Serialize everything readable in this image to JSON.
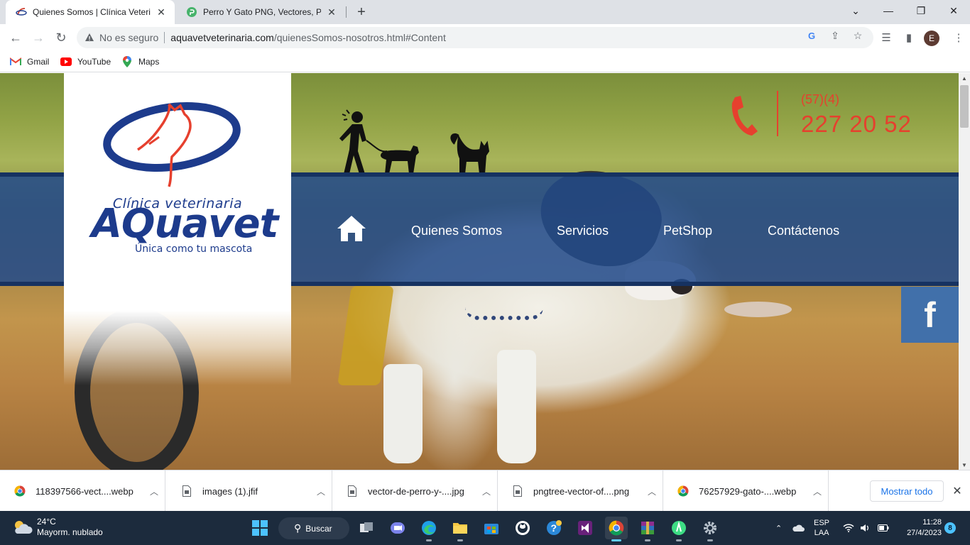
{
  "browser": {
    "tabs": [
      {
        "title": "Quienes Somos | Clínica Veterinaria",
        "active": true
      },
      {
        "title": "Perro Y Gato PNG, Vectores, PSD",
        "active": false
      }
    ],
    "security_label": "No es seguro",
    "url_domain": "aquavetveterinaria.com",
    "url_path": "/quienesSomos-nosotros.html#Content",
    "avatar_letter": "E",
    "bookmarks": [
      "Gmail",
      "YouTube",
      "Maps"
    ]
  },
  "site": {
    "logo": {
      "line1": "Clínica veterinaria",
      "brand": "AQuavet",
      "tagline": "Única como tu mascota"
    },
    "phone": {
      "area": "(57)(4)",
      "number": "227 20 52"
    },
    "nav": [
      "Quienes Somos",
      "Servicios",
      "PetShop",
      "Contáctenos"
    ],
    "facebook_letter": "f",
    "colors": {
      "nav_band": "#224a8a",
      "accent_red": "#e6402e",
      "brand_blue": "#1d3b8c",
      "facebook": "#3b6fb0"
    }
  },
  "downloads": {
    "items": [
      {
        "name": "118397566-vect....webp",
        "icon": "chrome-icon"
      },
      {
        "name": "images (1).jfif",
        "icon": "file-icon"
      },
      {
        "name": "vector-de-perro-y-....jpg",
        "icon": "file-icon"
      },
      {
        "name": "pngtree-vector-of....png",
        "icon": "file-icon"
      },
      {
        "name": "76257929-gato-....webp",
        "icon": "chrome-icon"
      }
    ],
    "show_all": "Mostrar todo"
  },
  "taskbar": {
    "weather_temp": "24°C",
    "weather_desc": "Mayorm. nublado",
    "search_label": "Buscar",
    "lang_line1": "ESP",
    "lang_line2": "LAA",
    "time": "11:28",
    "date": "27/4/2023",
    "notifications": "8"
  }
}
